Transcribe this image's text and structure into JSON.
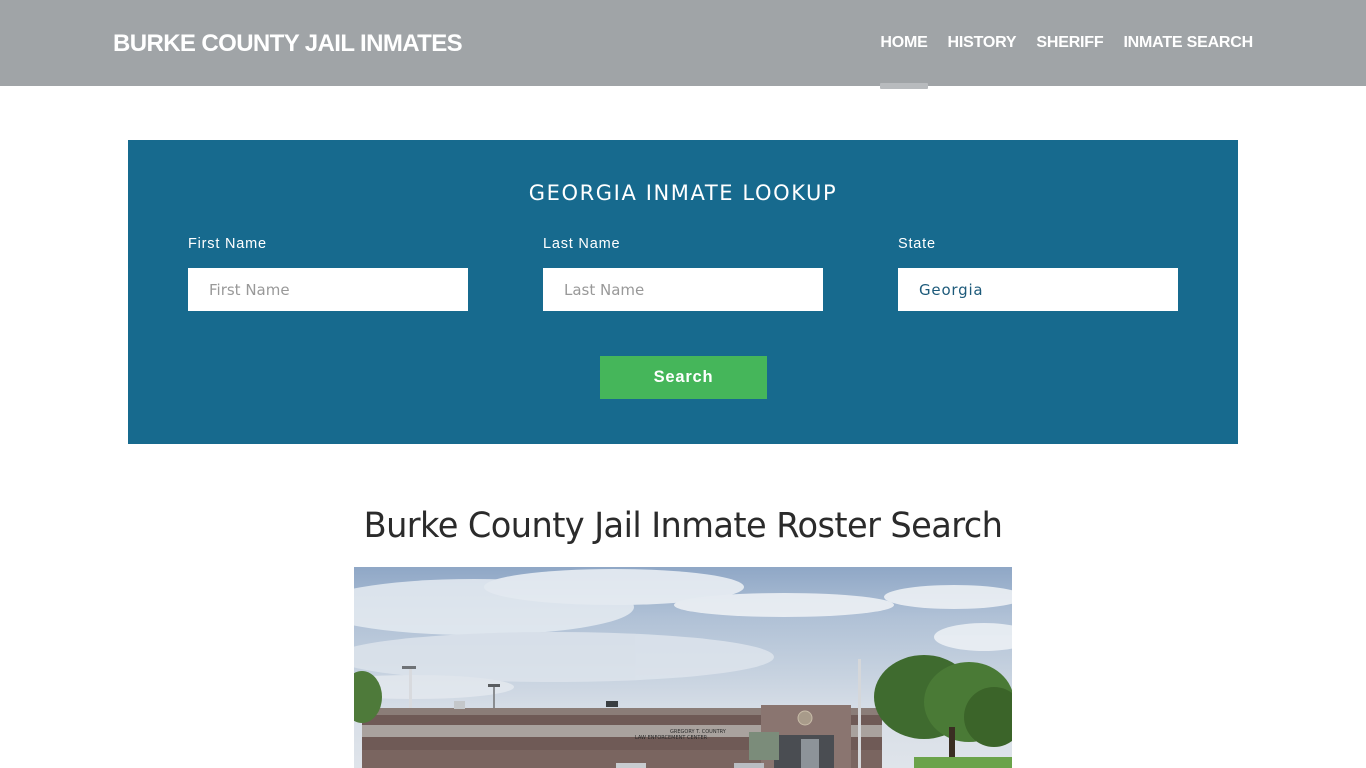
{
  "header": {
    "brand": "BURKE COUNTY JAIL INMATES",
    "nav": [
      {
        "label": "HOME",
        "active": true
      },
      {
        "label": "HISTORY",
        "active": false
      },
      {
        "label": "SHERIFF",
        "active": false
      },
      {
        "label": "INMATE SEARCH",
        "active": false
      }
    ]
  },
  "lookup": {
    "title": "GEORGIA INMATE LOOKUP",
    "first_name": {
      "label": "First Name",
      "placeholder": "First Name",
      "value": ""
    },
    "last_name": {
      "label": "Last Name",
      "placeholder": "Last Name",
      "value": ""
    },
    "state": {
      "label": "State",
      "value": "Georgia"
    },
    "search_label": "Search"
  },
  "main": {
    "headline": "Burke County Jail Inmate Roster Search",
    "photo": {
      "description": "Exterior view of law enforcement center building with trees and sky",
      "sign_text": "GREGORY T. COUNTRY LAW ENFORCEMENT CENTER"
    }
  },
  "colors": {
    "header_bg": "#a0a4a7",
    "panel_bg": "#176a8e",
    "button_bg": "#45b65a",
    "headline_text": "#2b2b2b"
  }
}
